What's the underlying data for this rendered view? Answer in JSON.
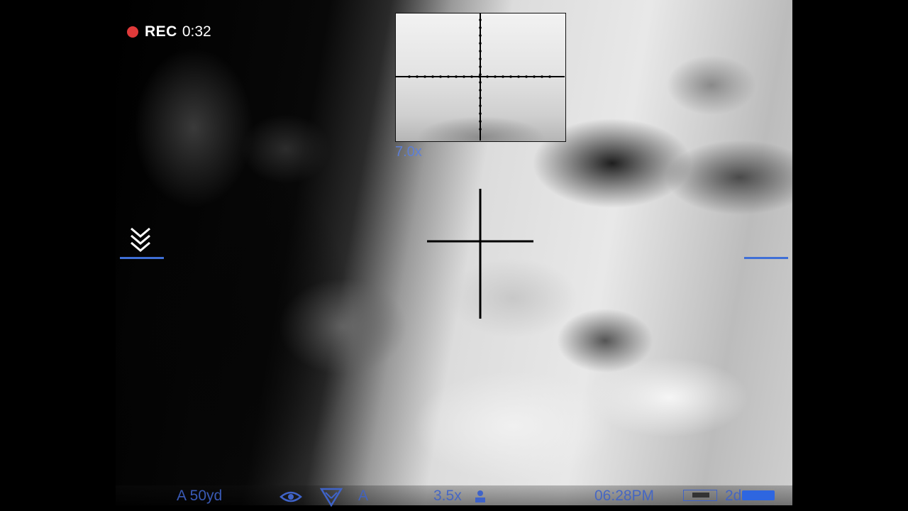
{
  "recording": {
    "label": "REC",
    "time": "0:32",
    "dot_color": "#e03a3a"
  },
  "zoom": {
    "level": "7.0x"
  },
  "status_bar": {
    "range": "A 50yd",
    "eye_icon": "eye-icon",
    "mode_icon": "triangle-mode-icon",
    "mode_letter": "A",
    "magnification": "3.5x",
    "clock": "06:28PM",
    "counter": "2d"
  },
  "markers": {
    "scroll_indicator_icon": "double-chevron-down-icon",
    "accent_color": "#3f6fd6"
  }
}
